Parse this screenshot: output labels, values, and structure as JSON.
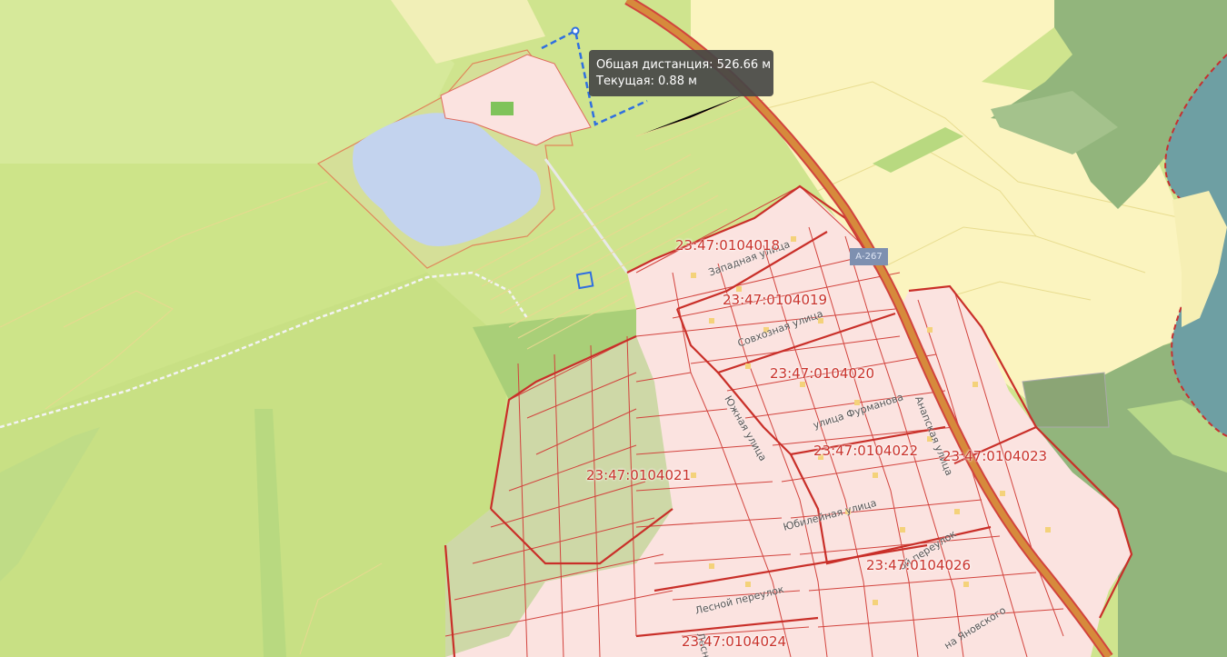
{
  "measure_tooltip": {
    "total_label": "Общая дистанция: 526.66 м",
    "current_label": "Текущая: 0.88 м"
  },
  "road_shield": "А-267",
  "quarters": {
    "q18": "23:47:0104018",
    "q19": "23:47:0104019",
    "q20": "23:47:0104020",
    "q21": "23:47:0104021",
    "q22": "23:47:0104022",
    "q23": "23:47:0104023",
    "q24": "23:47:0104024",
    "q26": "23:47:0104026"
  },
  "streets": {
    "zapadnaya": "Западная улица",
    "sovkhoznaya": "Совхозная улица",
    "yuzhnaya": "Южная улица",
    "furmanova": "улица Фурманова",
    "yubileynaya": "Юбилейная улица",
    "lesnoy": "Лесной переулок",
    "lesnoy_stub": "Лесной",
    "anapskaya": "Анапская улица",
    "pereulok": "ой переулок",
    "yanovskogo": "на Яновского"
  },
  "colors": {
    "field": "#cfe48e",
    "forest": "#a9cf78",
    "water": "#c3d3ee",
    "settlement": "#fbe3e0",
    "parcel_border": "#d2433d",
    "cropland": "#fbf4bf",
    "highway": "#d27b3b",
    "measure_line": "#2f6fe0"
  }
}
